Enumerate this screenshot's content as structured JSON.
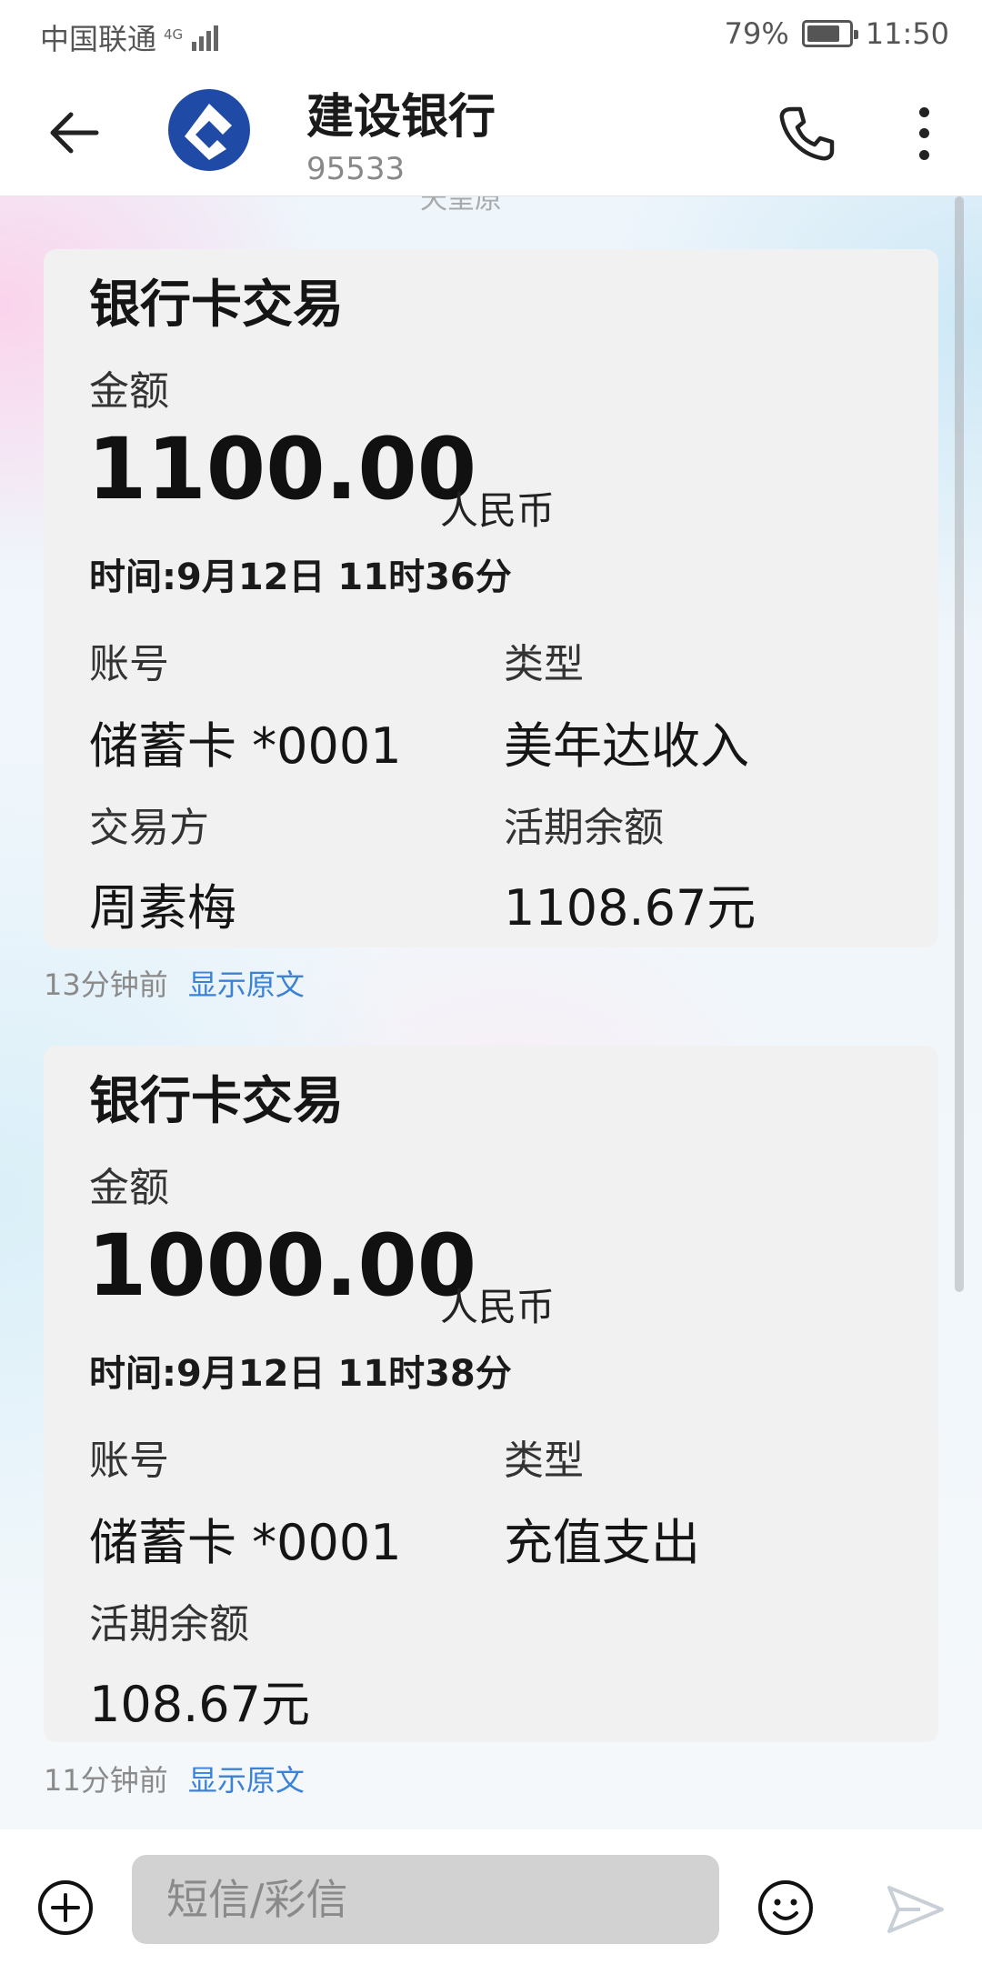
{
  "status_bar": {
    "carrier": "中国联通",
    "network": "4G",
    "battery": "79%",
    "battery_level": 0.79,
    "time": "11:50"
  },
  "header": {
    "title": "建设银行",
    "subtitle": "95533",
    "logo_color": "#1f4aa6"
  },
  "thread": {
    "clipped_text": "天呈原",
    "messages": [
      {
        "title": "银行卡交易",
        "amount_label": "金额",
        "amount": "1100.00",
        "currency": "人民币",
        "time": "时间:9月12日 11时36分",
        "account_label": "账号",
        "account_value": "储蓄卡 *0001",
        "type_label": "类型",
        "type_value": "美年达收入",
        "party_label": "交易方",
        "party_value": "周素梅",
        "balance_label": "活期余额",
        "balance_value": "1108.67元",
        "ago": "13分钟前",
        "show_original": "显示原文"
      },
      {
        "title": "银行卡交易",
        "amount_label": "金额",
        "amount": "1000.00",
        "currency": "人民币",
        "time": "时间:9月12日 11时38分",
        "account_label": "账号",
        "account_value": "储蓄卡 *0001",
        "type_label": "类型",
        "type_value": "充值支出",
        "balance_label": "活期余额",
        "balance_value": "108.67元",
        "ago": "11分钟前",
        "show_original": "显示原文"
      }
    ]
  },
  "composer": {
    "placeholder": "短信/彩信"
  },
  "colors": {
    "link": "#3b82d6",
    "card_bg": "#f1f1f1"
  }
}
